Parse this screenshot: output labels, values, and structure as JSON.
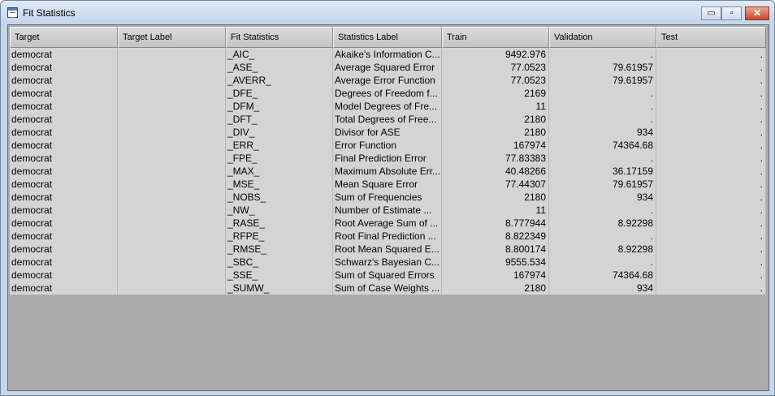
{
  "window": {
    "title": "Fit Statistics",
    "buttons": {
      "minimize": "▭",
      "maximize": "▫",
      "close": "✕"
    }
  },
  "table": {
    "columns": [
      "Target",
      "Target Label",
      "Fit Statistics",
      "Statistics Label",
      "Train",
      "Validation",
      "Test"
    ],
    "rows": [
      [
        "democrat",
        "",
        "_AIC_",
        "Akaike's Information C...",
        "9492.976",
        ".",
        "."
      ],
      [
        "democrat",
        "",
        "_ASE_",
        "Average Squared Error",
        "77.0523",
        "79.61957",
        "."
      ],
      [
        "democrat",
        "",
        "_AVERR_",
        "Average Error Function",
        "77.0523",
        "79.61957",
        "."
      ],
      [
        "democrat",
        "",
        "_DFE_",
        "Degrees of Freedom f...",
        "2169",
        ".",
        "."
      ],
      [
        "democrat",
        "",
        "_DFM_",
        "Model Degrees of Fre...",
        "11",
        ".",
        "."
      ],
      [
        "democrat",
        "",
        "_DFT_",
        "Total Degrees of Free...",
        "2180",
        ".",
        "."
      ],
      [
        "democrat",
        "",
        "_DIV_",
        "Divisor for ASE",
        "2180",
        "934",
        "."
      ],
      [
        "democrat",
        "",
        "_ERR_",
        "Error Function",
        "167974",
        "74364.68",
        "."
      ],
      [
        "democrat",
        "",
        "_FPE_",
        "Final Prediction Error",
        "77.83383",
        ".",
        "."
      ],
      [
        "democrat",
        "",
        "_MAX_",
        "Maximum Absolute Err...",
        "40.48266",
        "36.17159",
        "."
      ],
      [
        "democrat",
        "",
        "_MSE_",
        "Mean Square Error",
        "77.44307",
        "79.61957",
        "."
      ],
      [
        "democrat",
        "",
        "_NOBS_",
        "Sum of Frequencies",
        "2180",
        "934",
        "."
      ],
      [
        "democrat",
        "",
        "_NW_",
        "Number of Estimate ...",
        "11",
        ".",
        "."
      ],
      [
        "democrat",
        "",
        "_RASE_",
        "Root Average Sum of ...",
        "8.777944",
        "8.92298",
        "."
      ],
      [
        "democrat",
        "",
        "_RFPE_",
        "Root Final Prediction ...",
        "8.822349",
        ".",
        "."
      ],
      [
        "democrat",
        "",
        "_RMSE_",
        "Root Mean Squared E...",
        "8.800174",
        "8.92298",
        "."
      ],
      [
        "democrat",
        "",
        "_SBC_",
        "Schwarz's Bayesian C...",
        "9555.534",
        ".",
        "."
      ],
      [
        "democrat",
        "",
        "_SSE_",
        "Sum of Squared Errors",
        "167974",
        "74364.68",
        "."
      ],
      [
        "democrat",
        "",
        "_SUMW_",
        "Sum of Case Weights ...",
        "2180",
        "934",
        "."
      ]
    ]
  }
}
